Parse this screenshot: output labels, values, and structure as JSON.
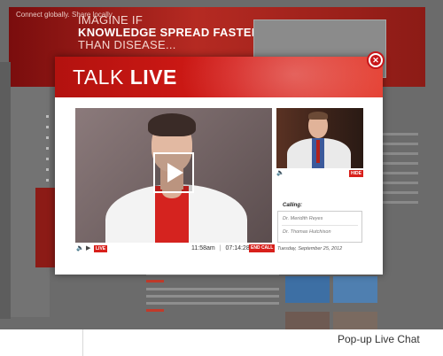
{
  "background_site": {
    "tagline": "Connect globally. Share locally.",
    "hero_line1": "IMAGINE IF",
    "hero_line2_bold": "KNOWLEDGE SPREAD FASTER",
    "hero_line3": "THAN DISEASE..."
  },
  "modal": {
    "title_light": "TALK",
    "title_bold": "LIVE",
    "close_icon": "close-icon",
    "accent_color": "#d41a16"
  },
  "main_video": {
    "play_icon": "play-icon",
    "volume_icon": "speaker-icon",
    "play_small_icon": "play-icon",
    "live_label": "LIVE",
    "time": "11:58am",
    "separator": "|",
    "elapsed": "07:14:28",
    "end_call_label": "END CALL"
  },
  "side_video": {
    "volume_icon": "speaker-icon",
    "hide_label": "HIDE"
  },
  "calling": {
    "label": "Calling:",
    "participants": [
      "Dr. Meridith Reyes",
      "Dr. Thomas Hutchison"
    ],
    "date": "Tuesday, September 25, 2012"
  },
  "caption": "Pop-up Live Chat"
}
